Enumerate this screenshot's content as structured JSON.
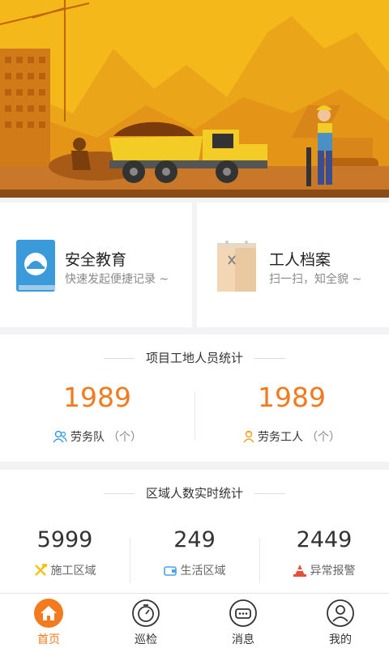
{
  "banner": {
    "icon": "construction-site-illustration"
  },
  "cards": [
    {
      "title": "安全教育",
      "subtitle": "快速发起便捷记录 ~",
      "icon": "safety-education-book-icon"
    },
    {
      "title": "工人档案",
      "subtitle": "扫一扫，知全貌 ~",
      "icon": "worker-file-icon"
    }
  ],
  "project_stats": {
    "title": "项目工地人员统计",
    "items": [
      {
        "value": "1989",
        "label": "劳务队",
        "unit": "（个）",
        "icon": "team-icon",
        "icon_color": "#3a9be8"
      },
      {
        "value": "1989",
        "label": "劳务工人",
        "unit": "（个）",
        "icon": "worker-icon",
        "icon_color": "#f4a21f"
      }
    ]
  },
  "area_stats": {
    "title": "区域人数实时统计",
    "items": [
      {
        "value": "5999",
        "label": "施工区域",
        "icon": "construction-area-icon",
        "icon_color": "#f0c419"
      },
      {
        "value": "249",
        "label": "生活区域",
        "icon": "living-area-icon",
        "icon_color": "#4aa3e8"
      },
      {
        "value": "2449",
        "label": "异常报警",
        "icon": "alarm-icon",
        "icon_color": "#e94e3c"
      }
    ]
  },
  "tabs": [
    {
      "label": "首页",
      "icon": "home-icon",
      "active": true
    },
    {
      "label": "巡检",
      "icon": "inspection-timer-icon",
      "active": false
    },
    {
      "label": "消息",
      "icon": "message-icon",
      "active": false
    },
    {
      "label": "我的",
      "icon": "profile-icon",
      "active": false
    }
  ],
  "colors": {
    "accent": "#f47a1f",
    "banner_yellow": "#f4b81b"
  }
}
